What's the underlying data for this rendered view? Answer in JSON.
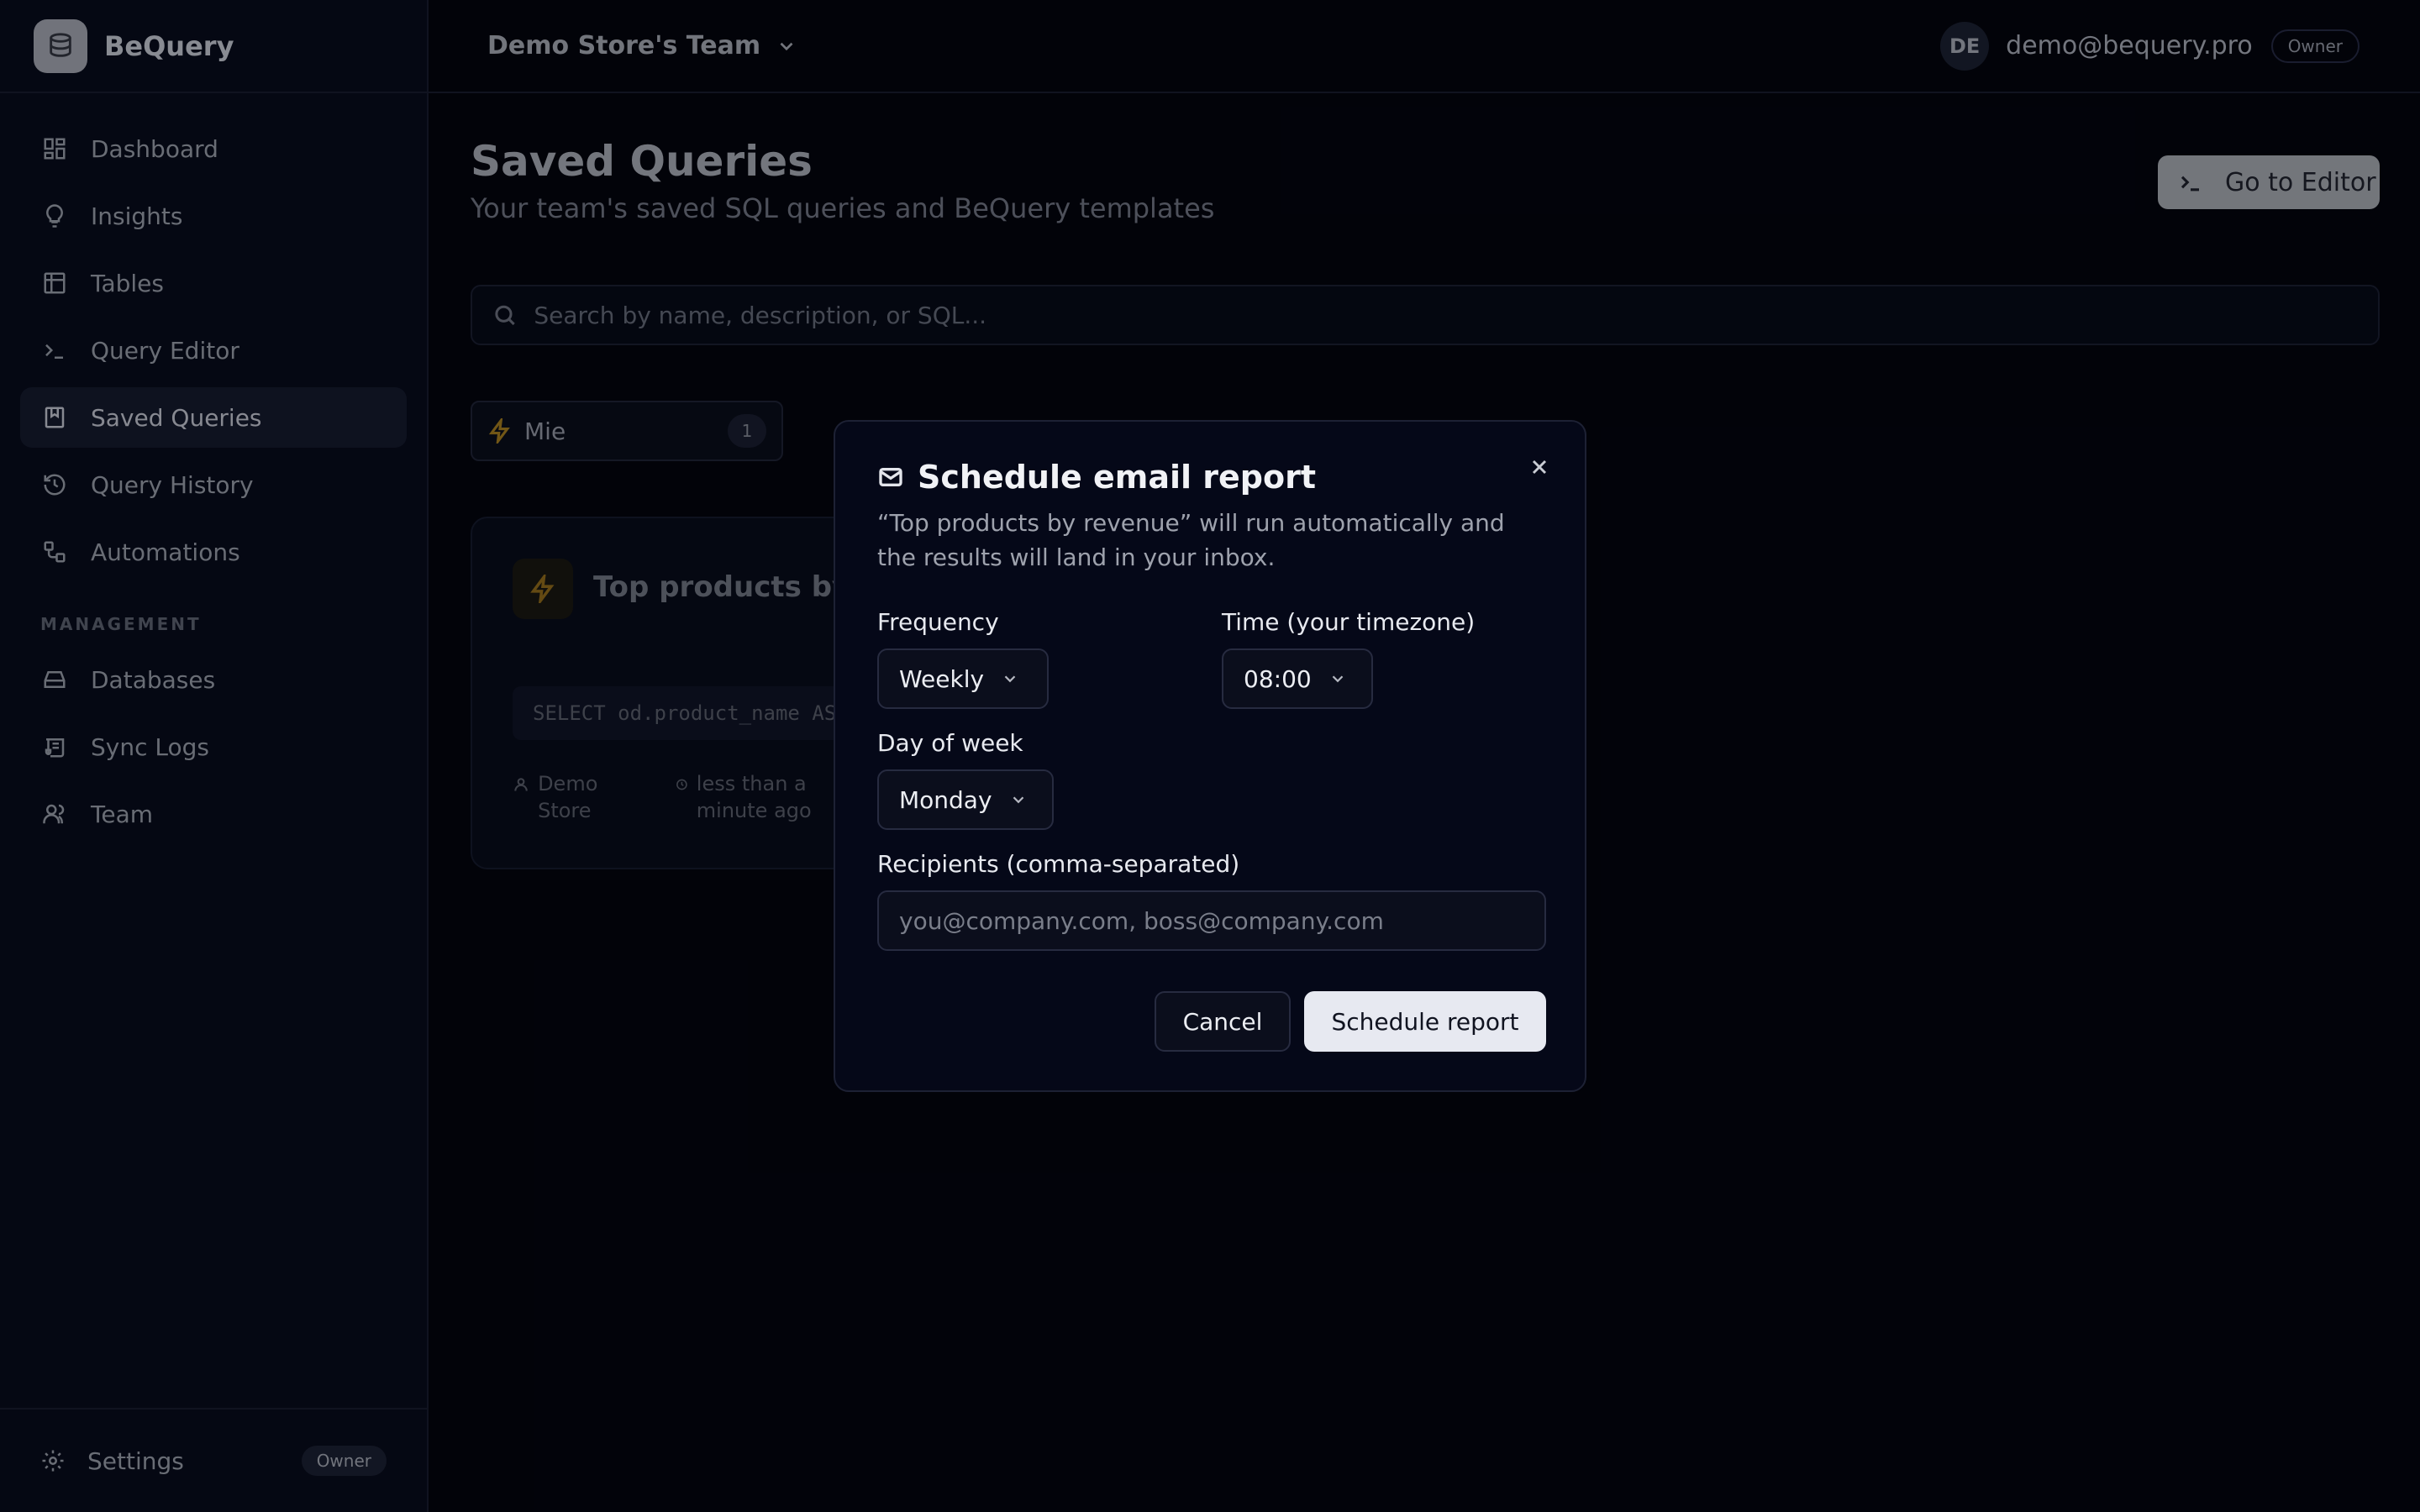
{
  "brand": {
    "name": "BeQuery"
  },
  "sidebar": {
    "items": [
      {
        "label": "Dashboard",
        "icon": "dashboard-icon"
      },
      {
        "label": "Insights",
        "icon": "lightbulb-icon"
      },
      {
        "label": "Tables",
        "icon": "table-icon"
      },
      {
        "label": "Query Editor",
        "icon": "terminal-icon"
      },
      {
        "label": "Saved Queries",
        "icon": "bookmark-icon",
        "active": true
      },
      {
        "label": "Query History",
        "icon": "history-icon"
      },
      {
        "label": "Automations",
        "icon": "workflow-icon"
      }
    ],
    "management_label": "MANAGEMENT",
    "management_items": [
      {
        "label": "Databases",
        "icon": "database-drive-icon"
      },
      {
        "label": "Sync Logs",
        "icon": "scroll-icon"
      },
      {
        "label": "Team",
        "icon": "users-icon"
      }
    ],
    "footer": {
      "label": "Settings",
      "badge": "Owner"
    }
  },
  "topbar": {
    "team": "Demo Store's Team",
    "avatar_initials": "DE",
    "email": "demo@bequery.pro",
    "role": "Owner"
  },
  "page": {
    "title": "Saved Queries",
    "subtitle": "Your team's saved SQL queries and BeQuery templates",
    "editor_button": "Go to Editor",
    "search_placeholder": "Search by name, description, or SQL...",
    "filter": {
      "label": "Mie",
      "count": "1"
    },
    "card": {
      "title": "Top products by revenue",
      "sql": "SELECT od.product_name AS product",
      "author": "Demo Store",
      "time": "less than a minute ago"
    }
  },
  "modal": {
    "title": "Schedule email report",
    "description": "“Top products by revenue” will run automatically and the results will land in your inbox.",
    "frequency_label": "Frequency",
    "frequency_value": "Weekly",
    "time_label": "Time (your timezone)",
    "time_value": "08:00",
    "day_label": "Day of week",
    "day_value": "Monday",
    "recipients_label": "Recipients (comma-separated)",
    "recipients_placeholder": "you@company.com, boss@company.com",
    "cancel": "Cancel",
    "submit": "Schedule report"
  },
  "colors": {
    "background": "#03040c",
    "sidebar": "#070a18",
    "accent_lightning": "#8a6a1c",
    "primary_button": "#e7e9f1"
  }
}
